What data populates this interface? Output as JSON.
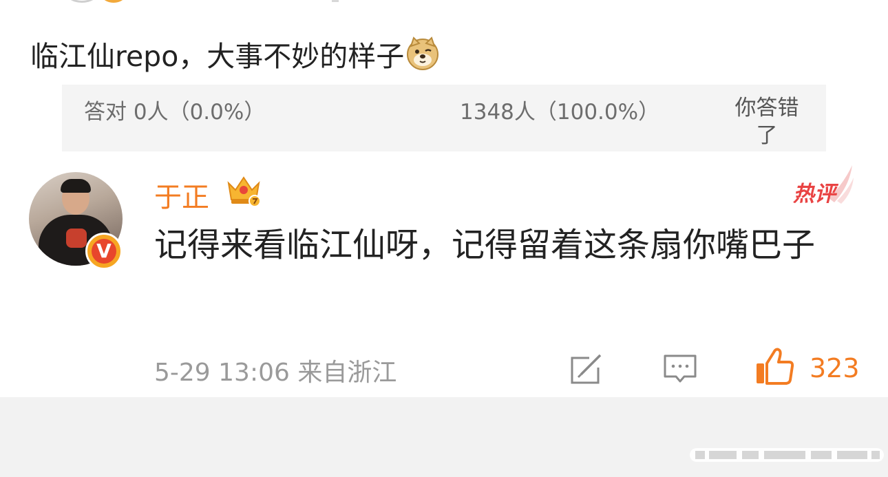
{
  "post": {
    "text": "临江仙repo，大事不妙的样子",
    "emoji_icon": "doge-icon"
  },
  "poll": {
    "correct": "答对  0人（0.0%）",
    "wrong": "1348人（100.0%）",
    "status": "你答错了"
  },
  "comment": {
    "username": "于正",
    "hot_label": "热评",
    "text": "记得来看临江仙呀，记得留着这条扇你嘴巴子",
    "verified_mark": "V",
    "meta": "5-29 13:06  来自浙江",
    "like_count": "323",
    "icons": {
      "crown": "crown-icon",
      "repost": "repost-icon",
      "comment": "comment-icon",
      "like": "thumbs-up-icon"
    },
    "colors": {
      "username": "#f37c22",
      "hot": "#e94343",
      "like": "#f37c22",
      "verified": "#f6a623"
    }
  }
}
